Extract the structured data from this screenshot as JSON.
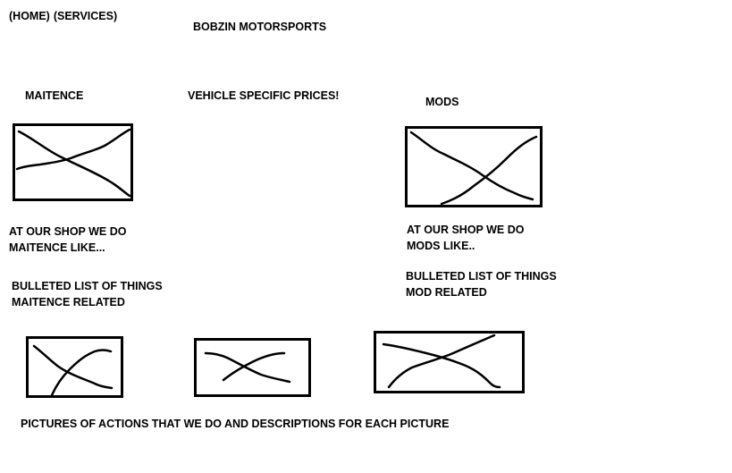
{
  "nav": {
    "home_label": "(HOME)",
    "services_label": "(SERVICES)"
  },
  "brand": "BOBZIN MOTORSPORTS",
  "sections": {
    "maintenance": {
      "title": "MAITENCE",
      "intro_line1": "AT OUR SHOP WE DO",
      "intro_line2": "MAITENCE LIKE...",
      "list_line1": "BULLETED LIST OF THINGS",
      "list_line2": "MAITENCE RELATED"
    },
    "prices": {
      "title": "VEHICLE SPECIFIC PRICES!"
    },
    "mods": {
      "title": "MODS",
      "intro_line1": "AT OUR SHOP WE DO",
      "intro_line2": "MODS LIKE..",
      "list_line1": "BULLETED LIST OF THINGS",
      "list_line2": "MOD RELATED"
    }
  },
  "gallery": {
    "caption": "PICTURES OF ACTIONS THAT WE DO AND DESCRIPTIONS FOR EACH PICTURE"
  },
  "colors": {
    "ink": "#000000",
    "background": "#ffffff"
  }
}
